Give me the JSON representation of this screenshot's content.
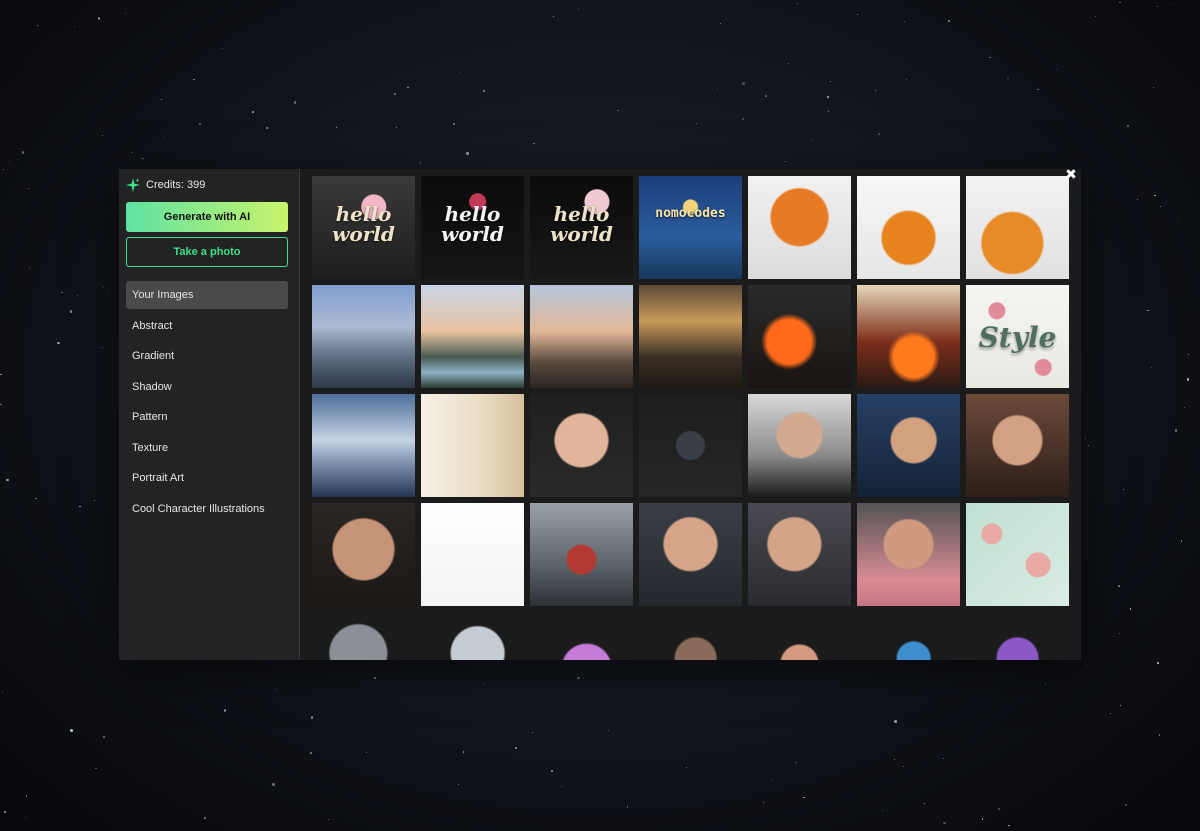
{
  "sidebar": {
    "credits_label": "Credits: 399",
    "generate_button": "Generate with AI",
    "photo_button": "Take a photo",
    "categories": [
      "Your Images",
      "Abstract",
      "Gradient",
      "Shadow",
      "Pattern",
      "Texture",
      "Portrait Art",
      "Cool Character Illustrations"
    ],
    "active_category": "Your Images",
    "accent_color": "#3ee08a"
  },
  "modal": {
    "close_icon": "close-icon"
  },
  "gallery": {
    "text_tiles": {
      "hello_world": "hello world",
      "nomocodes": "nomocodes",
      "style": "Style"
    },
    "tiles": [
      {
        "subject": "hello world floral text",
        "icon": "image-thumbnail"
      },
      {
        "subject": "hello world floral text dark",
        "icon": "image-thumbnail"
      },
      {
        "subject": "hello world rose text",
        "icon": "image-thumbnail"
      },
      {
        "subject": "nomocodes night bridge",
        "icon": "image-thumbnail"
      },
      {
        "subject": "orange jacket character",
        "icon": "image-thumbnail"
      },
      {
        "subject": "orange jacket character profile",
        "icon": "image-thumbnail"
      },
      {
        "subject": "orange jacket character side",
        "icon": "image-thumbnail"
      },
      {
        "subject": "mountain lake landscape",
        "icon": "image-thumbnail"
      },
      {
        "subject": "mountain at sunset",
        "icon": "image-thumbnail"
      },
      {
        "subject": "mountain over town",
        "icon": "image-thumbnail"
      },
      {
        "subject": "ancient city battle",
        "icon": "image-thumbnail"
      },
      {
        "subject": "burning ruins",
        "icon": "image-thumbnail"
      },
      {
        "subject": "temple on fire",
        "icon": "image-thumbnail"
      },
      {
        "subject": "style floral text",
        "icon": "image-thumbnail"
      },
      {
        "subject": "bottle in glass case",
        "icon": "image-thumbnail"
      },
      {
        "subject": "water bottle on table",
        "icon": "image-thumbnail"
      },
      {
        "subject": "surprised woman",
        "icon": "image-thumbnail"
      },
      {
        "subject": "microchip product",
        "icon": "image-thumbnail"
      },
      {
        "subject": "man holding chip",
        "icon": "image-thumbnail"
      },
      {
        "subject": "woman podcaster",
        "icon": "image-thumbnail"
      },
      {
        "subject": "woman with camera",
        "icon": "image-thumbnail"
      },
      {
        "subject": "old man portrait",
        "icon": "image-thumbnail"
      },
      {
        "subject": "pencil sketch face",
        "icon": "image-thumbnail"
      },
      {
        "subject": "spaceship interior",
        "icon": "image-thumbnail"
      },
      {
        "subject": "shocked man",
        "icon": "image-thumbnail"
      },
      {
        "subject": "shocked man office",
        "icon": "image-thumbnail"
      },
      {
        "subject": "excited woman",
        "icon": "image-thumbnail"
      },
      {
        "subject": "floral pattern",
        "icon": "image-thumbnail"
      },
      {
        "subject": "motorcycle helmet",
        "icon": "image-thumbnail"
      },
      {
        "subject": "astronaut helmet",
        "icon": "image-thumbnail"
      },
      {
        "subject": "colorful jacket man",
        "icon": "image-thumbnail"
      },
      {
        "subject": "man with glasses",
        "icon": "image-thumbnail"
      },
      {
        "subject": "woman with sunglasses",
        "icon": "image-thumbnail"
      },
      {
        "subject": "blue hair character",
        "icon": "image-thumbnail"
      },
      {
        "subject": "purple hair character",
        "icon": "image-thumbnail"
      }
    ]
  }
}
